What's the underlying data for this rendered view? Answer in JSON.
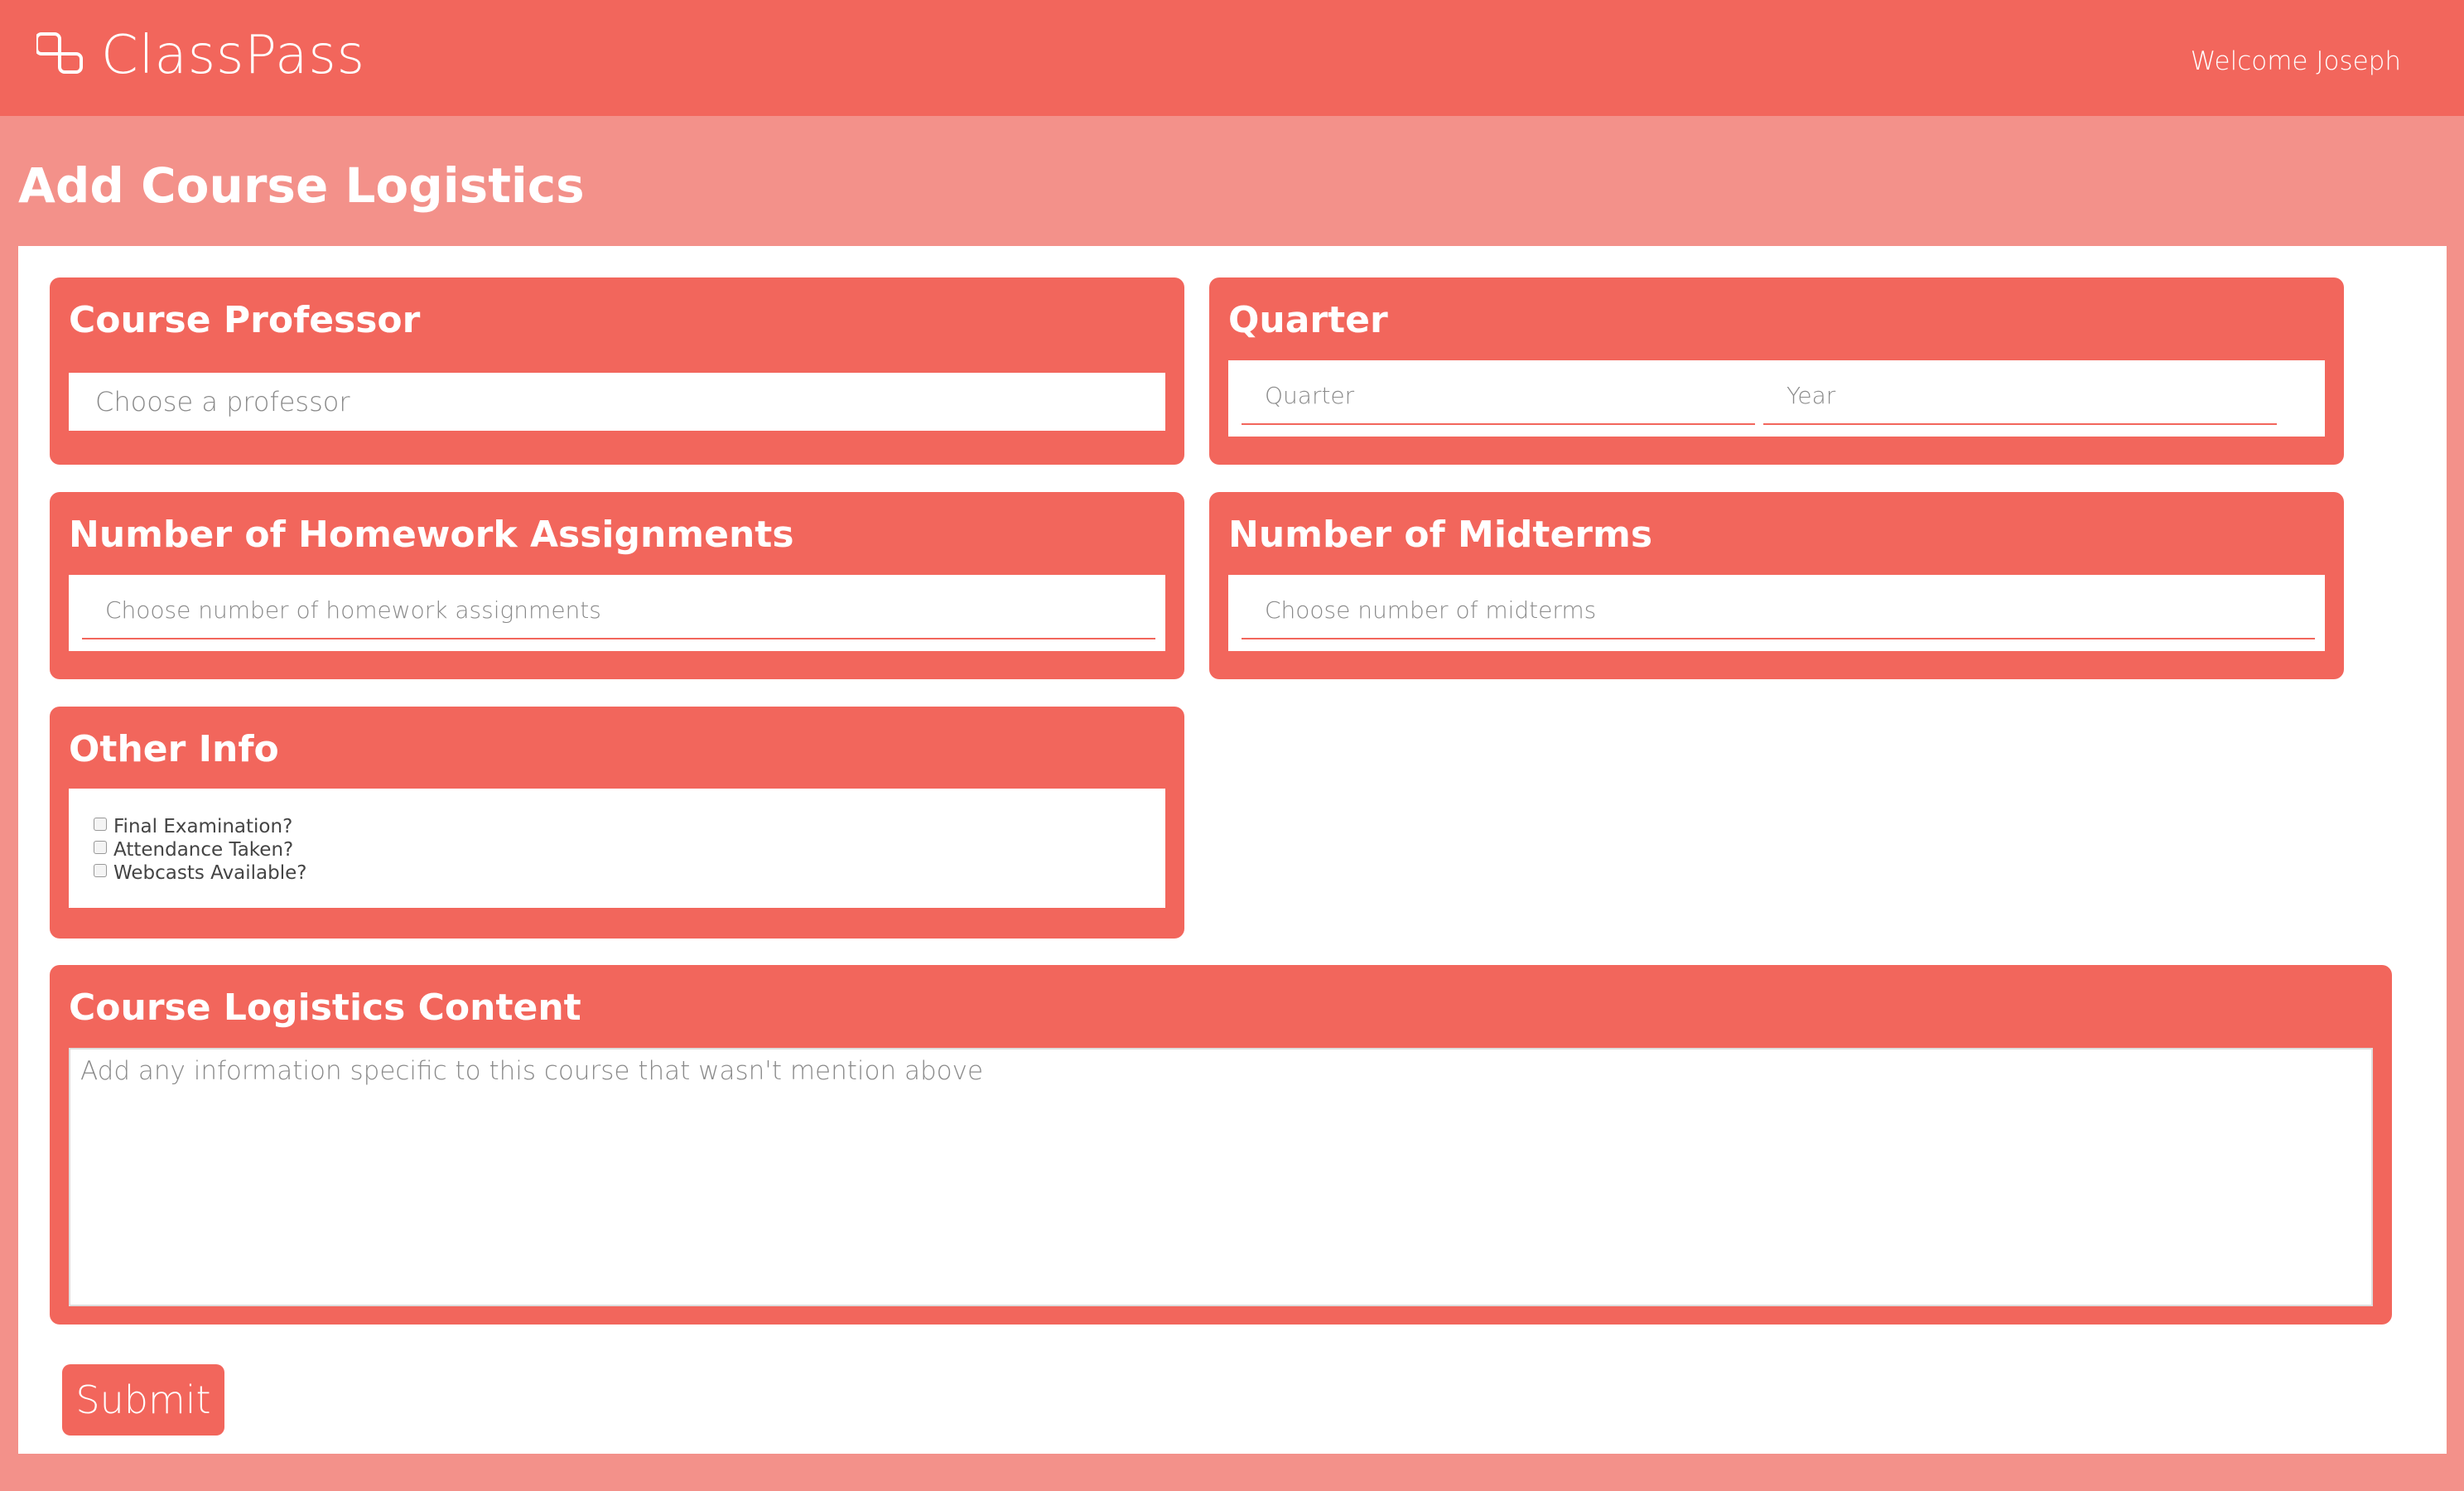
{
  "header": {
    "brand": "ClassPass",
    "welcome": "Welcome Joseph"
  },
  "page_title": "Add Course Logistics",
  "professor_card": {
    "title": "Course Professor",
    "placeholder": "Choose a professor"
  },
  "quarter_card": {
    "title": "Quarter",
    "quarter_placeholder": "Quarter",
    "year_placeholder": "Year"
  },
  "homework_card": {
    "title": "Number of Homework Assignments",
    "placeholder": "Choose number of homework assignments"
  },
  "midterms_card": {
    "title": "Number of Midterms",
    "placeholder": "Choose number of midterms"
  },
  "other_info_card": {
    "title": "Other Info",
    "options": [
      {
        "label": "Final Examination?",
        "checked": false
      },
      {
        "label": "Attendance Taken?",
        "checked": false
      },
      {
        "label": "Webcasts Available?",
        "checked": false
      }
    ]
  },
  "logistics_card": {
    "title": "Course Logistics Content",
    "placeholder": "Add any information specific to this course that wasn't mention above"
  },
  "submit_label": "Submit",
  "colors": {
    "primary": "#f2665c",
    "background": "#f3918a"
  }
}
